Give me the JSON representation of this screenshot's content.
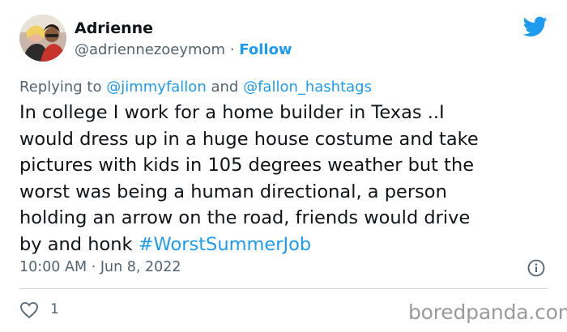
{
  "author": {
    "display_name": "Adrienne",
    "handle": "@adriennezoeymom",
    "separator": "·",
    "follow_label": "Follow"
  },
  "reply": {
    "prefix": "Replying to",
    "mention_1": "@jimmyfallon",
    "conjunction": "and",
    "mention_2": "@fallon_hashtags"
  },
  "tweet": {
    "lines": [
      "In college I work for a home builder in Texas ..I",
      "would dress up in a huge house costume and take",
      "pictures with kids in 105 degrees weather but the",
      "worst was being a human directional, a person",
      "holding an arrow on the road, friends would drive",
      "by and honk "
    ],
    "hashtag": "#WorstSummerJob"
  },
  "meta": {
    "time": "10:00 AM",
    "separator": "·",
    "date": "Jun 8, 2022"
  },
  "actions": {
    "like_count": "1"
  },
  "watermark": "boredpanda.com",
  "icons": [
    "twitter-bird-icon",
    "info-icon",
    "heart-icon"
  ],
  "colors": {
    "link": "#1d9bf0",
    "secondary_text": "#536471",
    "primary_text": "#0f1419",
    "divider": "#cfd9de",
    "watermark": "#9a9a9a"
  }
}
